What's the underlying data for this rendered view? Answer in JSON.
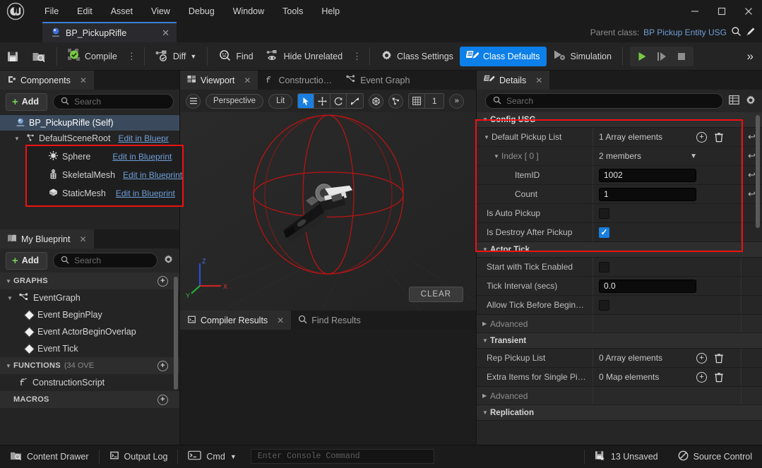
{
  "window": {
    "minimize_icon": "minimize-icon",
    "maximize_icon": "maximize-icon",
    "close_icon": "close-icon"
  },
  "menubar": {
    "logo_name": "unreal-engine-logo",
    "items": [
      "File",
      "Edit",
      "Asset",
      "View",
      "Debug",
      "Window",
      "Tools",
      "Help"
    ]
  },
  "asset_tab": {
    "label": "BP_PickupRifle",
    "icon": "blueprint-icon",
    "close_icon": "close-icon"
  },
  "parent_class": {
    "label": "Parent class:",
    "value": "BP Pickup Entity USG",
    "browse_icon": "magnifier-icon",
    "edit_icon": "pencil-icon"
  },
  "toolbar": {
    "save_icon": "save-icon",
    "browse_icon": "browse-content-icon",
    "compile_label": "Compile",
    "compile_icon": "compile-check-icon",
    "diff_label": "Diff",
    "diff_icon": "diff-icon",
    "find_label": "Find",
    "find_icon": "find-icon",
    "hide_unrelated_label": "Hide Unrelated",
    "hide_unrelated_icon": "hide-unrelated-icon",
    "class_settings_label": "Class Settings",
    "class_settings_icon": "gear-icon",
    "class_defaults_label": "Class Defaults",
    "class_defaults_icon": "class-defaults-icon",
    "simulation_label": "Simulation",
    "simulation_icon": "simulation-icon",
    "play_icon": "play-icon",
    "step_icon": "step-icon",
    "stop_icon": "stop-icon",
    "overflow_icon": "double-chevron-right-icon",
    "dots_icon": "vertical-dots-icon"
  },
  "components_panel": {
    "tab_label": "Components",
    "tab_icon": "components-icon",
    "close_icon": "close-icon",
    "add_label": "Add",
    "search_placeholder": "Search",
    "search_icon": "search-icon",
    "tree": [
      {
        "label": "BP_PickupRifle (Self)",
        "icon": "actor-icon",
        "selected": true,
        "depth": 0,
        "link": ""
      },
      {
        "label": "DefaultSceneRoot",
        "icon": "scene-root-icon",
        "selected": false,
        "depth": 1,
        "link": "Edit in Bluepr"
      },
      {
        "label": "Sphere",
        "icon": "sphere-collision-icon",
        "selected": false,
        "depth": 2,
        "link": "Edit in Blueprint"
      },
      {
        "label": "SkeletalMesh",
        "icon": "skeletal-mesh-icon",
        "selected": false,
        "depth": 2,
        "link": "Edit in Blueprint"
      },
      {
        "label": "StaticMesh",
        "icon": "static-mesh-icon",
        "selected": false,
        "depth": 2,
        "link": "Edit in Blueprint"
      }
    ]
  },
  "my_blueprint_panel": {
    "tab_label": "My Blueprint",
    "tab_icon": "my-blueprint-icon",
    "close_icon": "close-icon",
    "add_label": "Add",
    "search_placeholder": "Search",
    "settings_icon": "gear-icon",
    "sections": [
      {
        "title": "GRAPHS",
        "suffix": "",
        "expanded": true,
        "items": [
          {
            "label": "EventGraph",
            "icon": "event-graph-icon",
            "depth": 1,
            "expandable": true
          },
          {
            "label": "Event BeginPlay",
            "icon": "event-node-icon",
            "depth": 2,
            "expandable": false
          },
          {
            "label": "Event ActorBeginOverlap",
            "icon": "event-node-icon",
            "depth": 2,
            "expandable": false
          },
          {
            "label": "Event Tick",
            "icon": "event-node-icon",
            "depth": 2,
            "expandable": false
          }
        ]
      },
      {
        "title": "FUNCTIONS",
        "suffix": "(34 OVE",
        "expanded": true,
        "items": [
          {
            "label": "ConstructionScript",
            "icon": "function-icon",
            "depth": 1,
            "expandable": false
          }
        ]
      },
      {
        "title": "MACROS",
        "suffix": "",
        "expanded": false,
        "items": []
      }
    ]
  },
  "viewport_panel": {
    "tabs": [
      {
        "label": "Viewport",
        "icon": "viewport-icon",
        "selected": true,
        "closable": true
      },
      {
        "label": "Constructio…",
        "icon": "function-icon",
        "selected": false,
        "closable": false
      },
      {
        "label": "Event Graph",
        "icon": "event-graph-icon",
        "selected": false,
        "closable": false
      }
    ],
    "close_icon": "close-icon",
    "toolbar": {
      "menu_icon": "hamburger-icon",
      "camera_mode": "Perspective",
      "view_mode": "Lit",
      "select_icon": "cursor-select-icon",
      "translate_icon": "move-gizmo-icon",
      "rotate_icon": "rotate-gizmo-icon",
      "scale_icon": "scale-gizmo-icon",
      "coordinate_icon": "world-coordinate-icon",
      "snap_icon": "surface-snap-icon",
      "grid_icon": "grid-snap-icon",
      "grid_value": "1",
      "overflow_icon": "double-chevron-right-icon"
    },
    "axis_labels": {
      "x": "X",
      "y": "Y",
      "z": "Z"
    },
    "clear_button": "CLEAR",
    "scene_description": "Rifle static mesh inside red wireframe sphere collision"
  },
  "bottom_panel": {
    "tabs": [
      {
        "label": "Compiler Results",
        "icon": "compiler-results-icon",
        "selected": true,
        "closable": true
      },
      {
        "label": "Find Results",
        "icon": "search-icon",
        "selected": false,
        "closable": false
      }
    ],
    "close_icon": "close-icon"
  },
  "details_panel": {
    "tab_label": "Details",
    "tab_icon": "details-icon",
    "close_icon": "close-icon",
    "search_placeholder": "Search",
    "search_icon": "search-icon",
    "column_icon": "column-layout-icon",
    "settings_icon": "gear-icon",
    "revert_icon": "revert-arrow-icon",
    "add_element_icon": "circle-plus-icon",
    "delete_icon": "trash-icon",
    "rows": [
      {
        "kind": "category",
        "name": "Config USG",
        "expanded": true
      },
      {
        "kind": "array",
        "name": "Default Pickup List",
        "value": "1 Array elements",
        "indent": 1,
        "expanded": true,
        "has_add": true,
        "has_delete": true,
        "has_revert": true
      },
      {
        "kind": "struct",
        "name": "Index [ 0 ]",
        "value": "2 members",
        "indent": 2,
        "expanded": true,
        "dim": true,
        "has_dropdown": true,
        "has_revert": true
      },
      {
        "kind": "text",
        "name": "ItemID",
        "value": "1002",
        "indent": 3,
        "has_revert": true
      },
      {
        "kind": "text",
        "name": "Count",
        "value": "1",
        "indent": 3,
        "has_revert": true
      },
      {
        "kind": "checkbox",
        "name": "Is Auto Pickup",
        "checked": false,
        "indent": 1
      },
      {
        "kind": "checkbox",
        "name": "Is Destroy After Pickup",
        "checked": true,
        "indent": 1
      },
      {
        "kind": "category",
        "name": "Actor Tick",
        "expanded": true
      },
      {
        "kind": "checkbox",
        "name": "Start with Tick Enabled",
        "checked": false,
        "indent": 1
      },
      {
        "kind": "text",
        "name": "Tick Interval (secs)",
        "value": "0.0",
        "indent": 1
      },
      {
        "kind": "checkbox",
        "name": "Allow Tick Before Begin…",
        "checked": false,
        "indent": 1
      },
      {
        "kind": "subcat",
        "name": "Advanced",
        "expanded": false
      },
      {
        "kind": "category",
        "name": "Transient",
        "expanded": true
      },
      {
        "kind": "array",
        "name": "Rep Pickup List",
        "value": "0 Array elements",
        "indent": 1,
        "has_add": true,
        "has_delete": true
      },
      {
        "kind": "array",
        "name": "Extra Items for Single Pi…",
        "value": "0 Map elements",
        "indent": 1,
        "has_add": true,
        "has_delete": true
      },
      {
        "kind": "subcat",
        "name": "Advanced",
        "expanded": false
      },
      {
        "kind": "category",
        "name": "Replication",
        "expanded": true
      }
    ]
  },
  "statusbar": {
    "content_drawer": "Content Drawer",
    "content_drawer_icon": "content-drawer-icon",
    "output_log": "Output Log",
    "output_log_icon": "output-log-icon",
    "cmd_label": "Cmd",
    "cmd_icon": "console-icon",
    "console_placeholder": "Enter Console Command",
    "unsaved": "13 Unsaved",
    "unsaved_icon": "unsaved-icon",
    "source_control": "Source Control",
    "source_control_icon": "source-control-off-icon"
  },
  "annotations": {
    "accent_red": "#ee1111",
    "boxes": [
      "components-highlight",
      "config-usg-highlight"
    ]
  },
  "colors": {
    "accent_blue": "#0c7fe8",
    "link_blue": "#6f9fd8",
    "green_plus": "#77d055",
    "panel_bg": "#262626",
    "annotation_red": "#ee1111"
  }
}
